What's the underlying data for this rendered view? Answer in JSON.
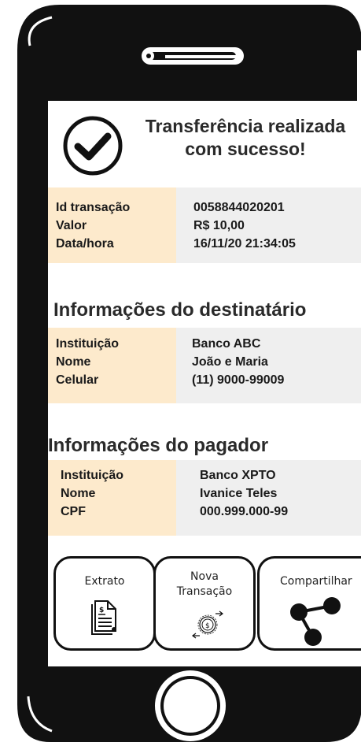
{
  "success": {
    "title_line1": "Transferência realizada",
    "title_line2": "com sucesso!",
    "icon": "check-circle-icon"
  },
  "transaction": {
    "rows": [
      {
        "label": "Id transação",
        "value": "0058844020201"
      },
      {
        "label": "Valor",
        "value": "R$ 10,00"
      },
      {
        "label": "Data/hora",
        "value": "16/11/20  21:34:05"
      }
    ]
  },
  "recipient": {
    "title": "Informações do destinatário",
    "rows": [
      {
        "label": "Instituição",
        "value": "Banco ABC"
      },
      {
        "label": "Nome",
        "value": "João e Maria"
      },
      {
        "label": "Celular",
        "value": "(11) 9000-99009"
      }
    ]
  },
  "payer": {
    "title": "Informações do pagador",
    "rows": [
      {
        "label": "Instituição",
        "value": "Banco  XPTO"
      },
      {
        "label": "Nome",
        "value": "Ivanice Teles"
      },
      {
        "label": "CPF",
        "value": "000.999.000-99"
      }
    ]
  },
  "actions": {
    "extrato": {
      "label": "Extrato",
      "icon": "statement-document-icon"
    },
    "nova": {
      "label_line1": "Nova",
      "label_line2": "Transação",
      "icon": "money-transfer-icon"
    },
    "compartilhar": {
      "label": "Compartilhar",
      "icon": "share-icon"
    }
  },
  "colors": {
    "label_bg": "#fdeacc",
    "value_bg": "#efefef",
    "phone_body": "#111111"
  }
}
